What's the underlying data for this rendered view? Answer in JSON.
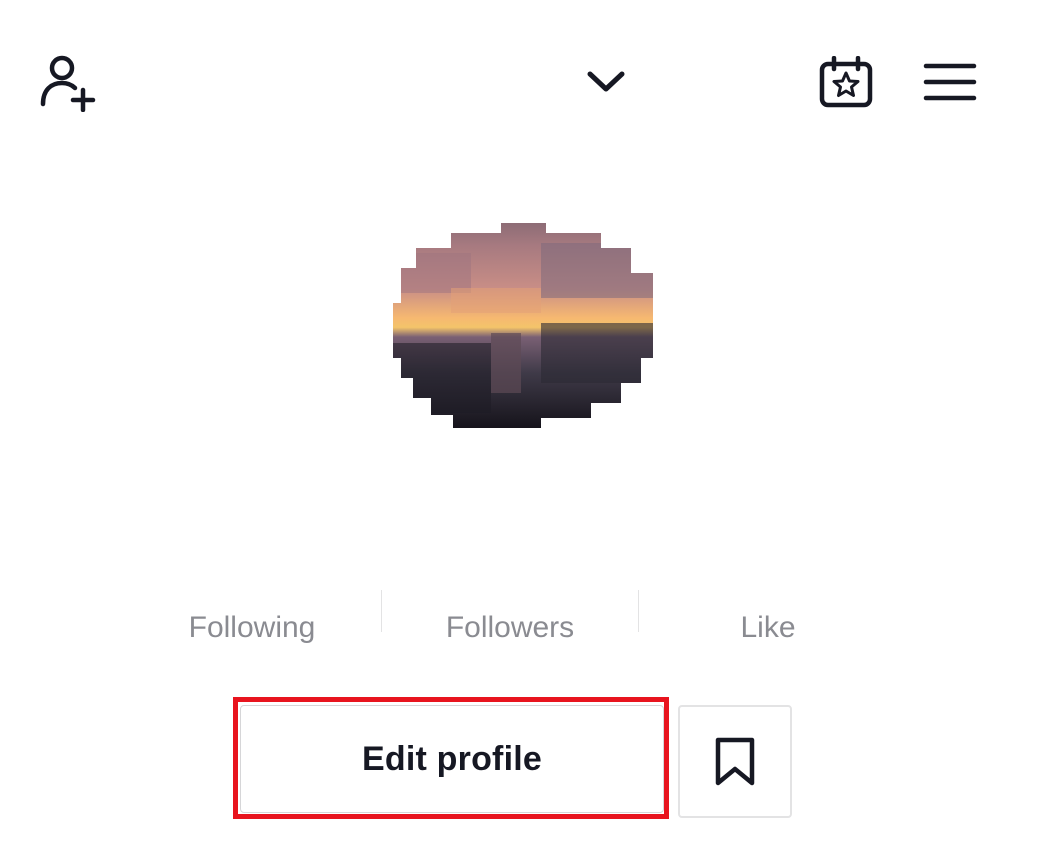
{
  "header": {
    "add_friend_icon": "person-plus-icon",
    "account_switch_icon": "chevron-down-icon",
    "calendar_icon": "calendar-star-icon",
    "menu_icon": "hamburger-menu-icon"
  },
  "profile": {
    "avatar": "pixelated-sunset-avatar"
  },
  "stats": {
    "following_label": "Following",
    "followers_label": "Followers",
    "likes_label": "Like"
  },
  "actions": {
    "edit_profile_label": "Edit profile",
    "bookmark_icon": "bookmark-icon",
    "highlight_color": "#e8141e"
  }
}
